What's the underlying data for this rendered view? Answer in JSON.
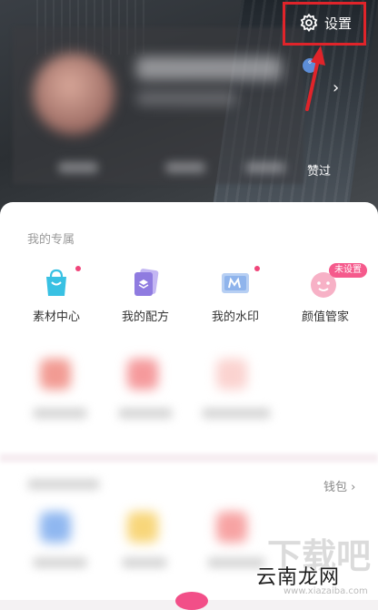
{
  "header": {
    "settings_label": "设置",
    "liked_label": "赞过",
    "badge_text": "°",
    "chevron": "›"
  },
  "exclusive": {
    "section_title": "我的专属",
    "items": [
      {
        "label": "素材中心",
        "icon": "shopping-bag-icon",
        "color": "#39c1e3",
        "has_dot": true
      },
      {
        "label": "我的配方",
        "icon": "recipe-stack-icon",
        "color": "#8f7be0",
        "has_dot": false
      },
      {
        "label": "我的水印",
        "icon": "watermark-icon",
        "color": "#8fb4ec",
        "has_dot": true
      },
      {
        "label": "颜值管家",
        "icon": "smiley-face-icon",
        "color": "#f49ab6",
        "has_dot": false
      }
    ],
    "unset_badge": "未设置"
  },
  "wallet": {
    "label": "钱包",
    "chevron": "›"
  },
  "watermark": {
    "site_name": "云南龙网",
    "big_text": "下载吧",
    "url_text": "www.xiazaiba.com"
  },
  "colors": {
    "highlight_red": "#e0242a",
    "accent_pink": "#f55a8c"
  }
}
